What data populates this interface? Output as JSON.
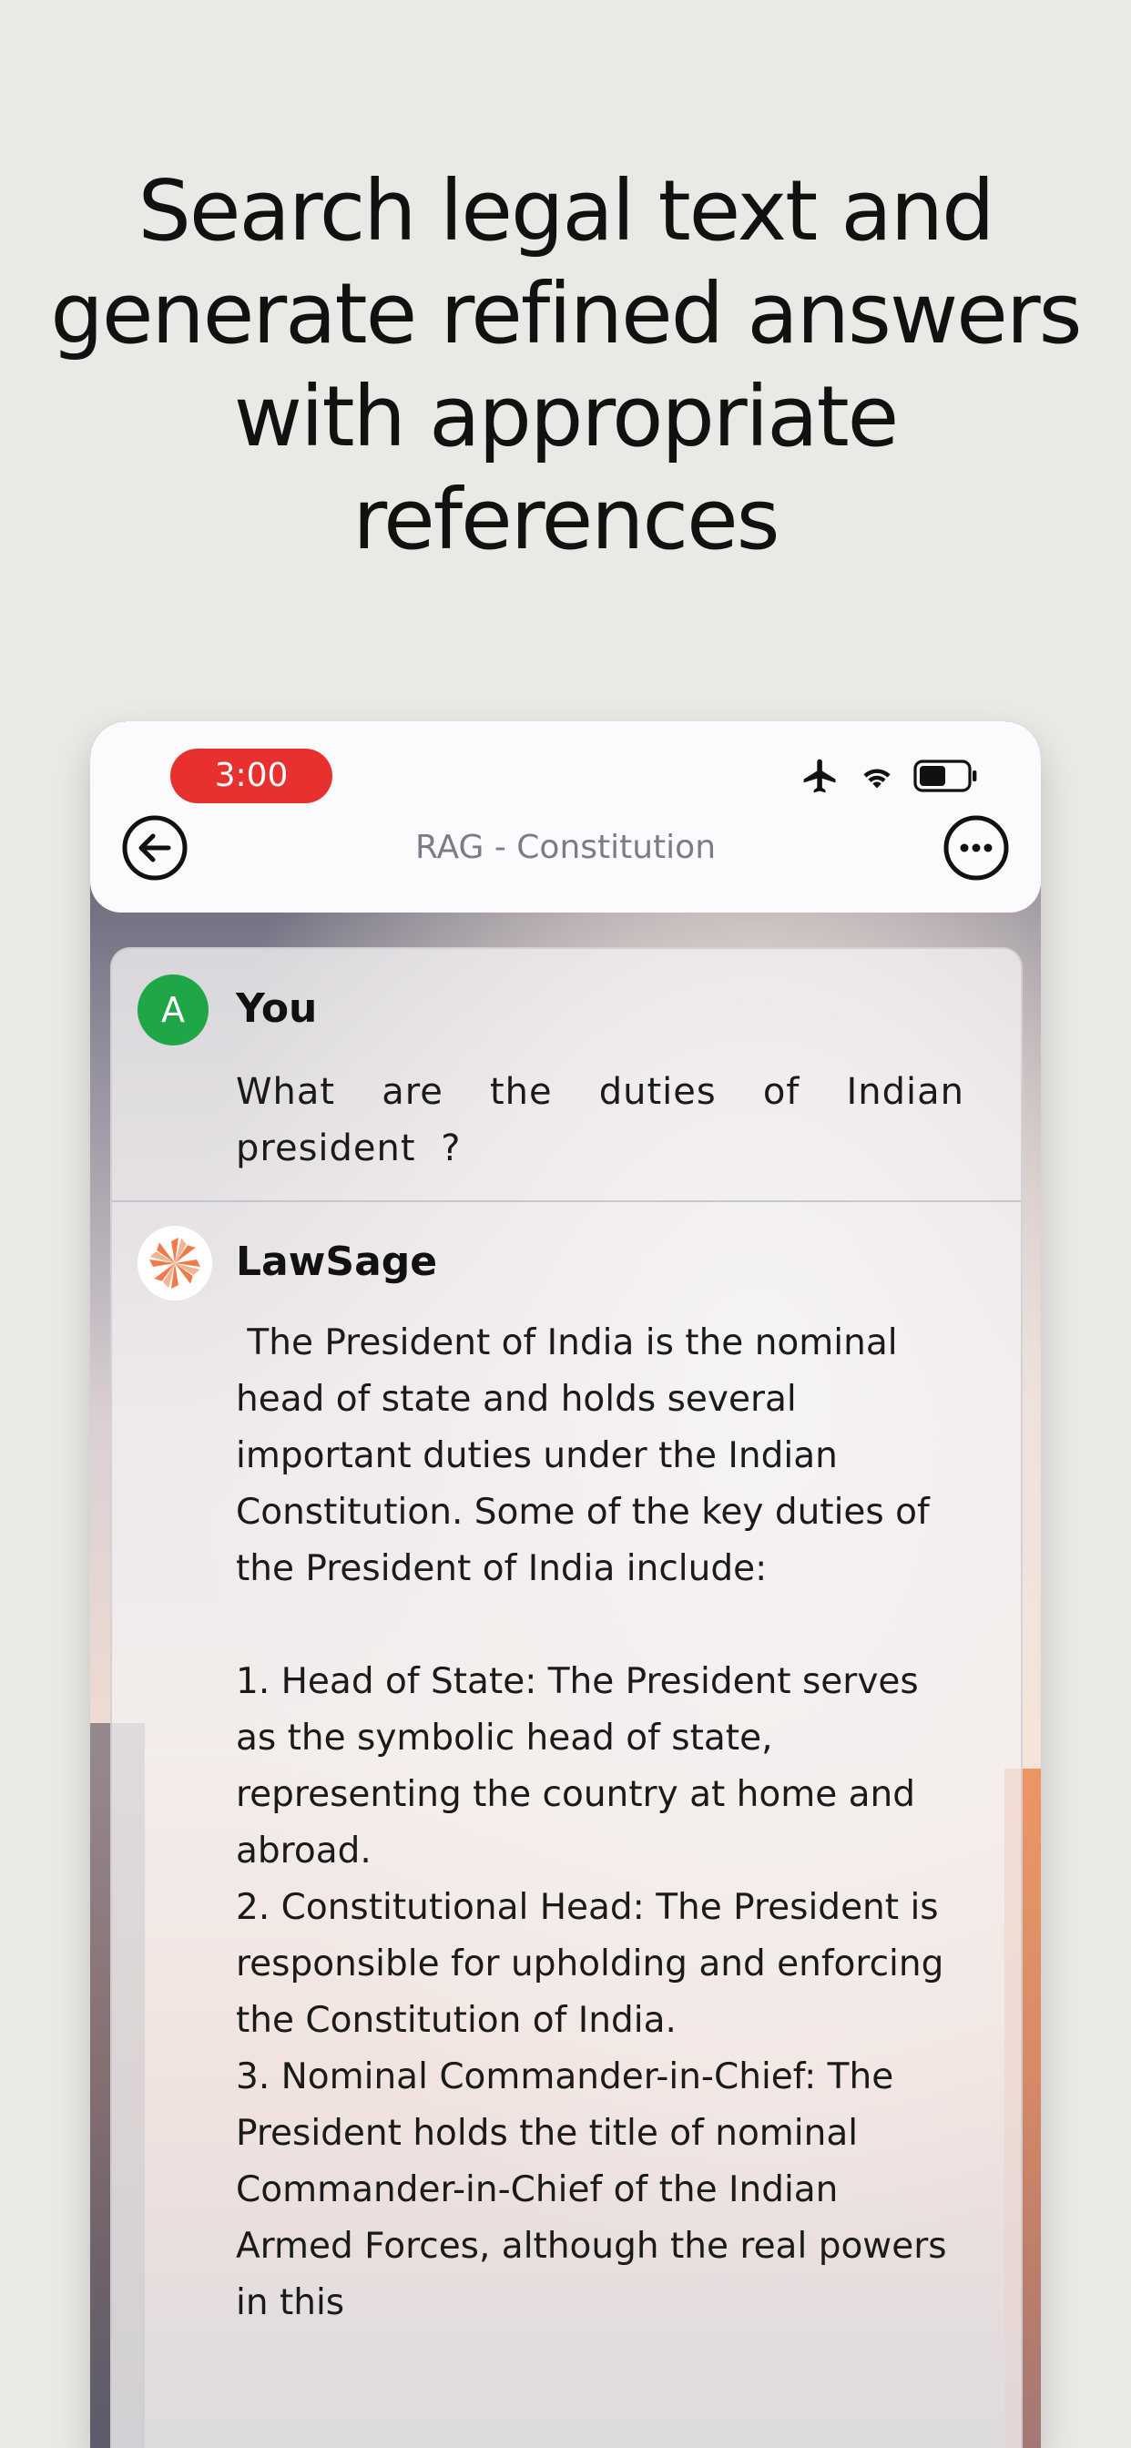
{
  "headline": "Search legal text and\ngenerate refined answers\nwith appropriate\nreferences",
  "status_bar": {
    "time": "3:00",
    "icons": [
      "airplane-icon",
      "wifi-icon",
      "battery-icon"
    ]
  },
  "nav": {
    "title": "RAG - Constitution",
    "back_icon": "back-arrow-icon",
    "menu_icon": "more-options-icon"
  },
  "messages": [
    {
      "sender": "You",
      "avatar_letter": "A",
      "avatar_color": "#1ea647",
      "text": "What are the duties of Indian president ?"
    },
    {
      "sender": "LawSage",
      "avatar_icon": "lawsage-logo-icon",
      "avatar_color": "#f07a4a",
      "text": " The President of India is the nominal head of state and holds several important duties under the Indian Constitution. Some of the key duties of the President of India include:\n\n1. Head of State: The President serves as the symbolic head of state, representing the country at home and abroad.\n2. Constitutional Head: The President is responsible for upholding and enforcing the Constitution of India.\n3. Nominal Commander-in-Chief: The President holds the title of nominal Commander-in-Chief of the Indian Armed Forces, although the real powers in this"
    }
  ]
}
